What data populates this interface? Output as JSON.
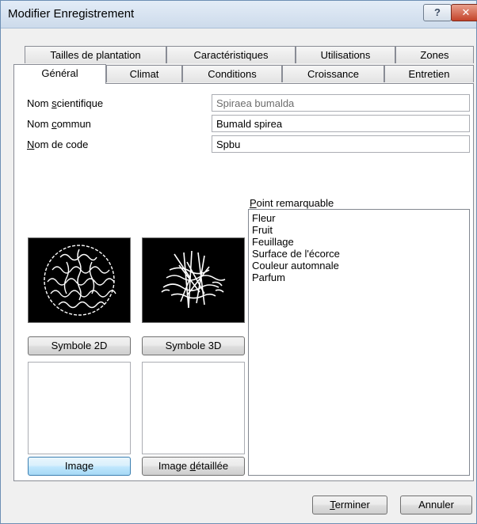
{
  "window": {
    "title": "Modifier Enregistrement",
    "help_glyph": "?",
    "close_glyph": "✕"
  },
  "tabs_row1": [
    "Tailles de plantation",
    "Caractéristiques",
    "Utilisations",
    "Zones"
  ],
  "tabs_row2": [
    "Général",
    "Climat",
    "Conditions",
    "Croissance",
    "Entretien"
  ],
  "fields": {
    "scientific_label": {
      "pre": "Nom ",
      "key": "s",
      "post": "cientifique"
    },
    "scientific_value": "Spiraea bumalda",
    "common_label": {
      "pre": "Nom ",
      "key": "c",
      "post": "ommun"
    },
    "common_value": "Bumald spirea",
    "code_label": {
      "pre": "",
      "key": "N",
      "post": "om de code"
    },
    "code_value": "Spbu"
  },
  "remarkable": {
    "label_key": "P",
    "label_rest": "oint remarquable",
    "items": [
      "Fleur",
      "Fruit",
      "Feuillage",
      "Surface de l'écorce",
      "Couleur automnale",
      "Parfum"
    ]
  },
  "buttons": {
    "symbol2d": "Symbole 2D",
    "symbol3d": "Symbole 3D",
    "image": "Image",
    "image_detailed_pre": "Image ",
    "image_detailed_key": "d",
    "image_detailed_post": "étaillée",
    "finish_key": "T",
    "finish_rest": "erminer",
    "cancel": "Annuler"
  },
  "icons": {
    "symbol2d_preview": "plant-2d-symbol-icon",
    "symbol3d_preview": "plant-3d-symbol-icon",
    "help": "help-icon",
    "close": "close-icon"
  },
  "colors": {
    "focus_blue": "#3c7fb1",
    "close_red": "#c4432a",
    "title_bg": "#dbe6f3"
  }
}
